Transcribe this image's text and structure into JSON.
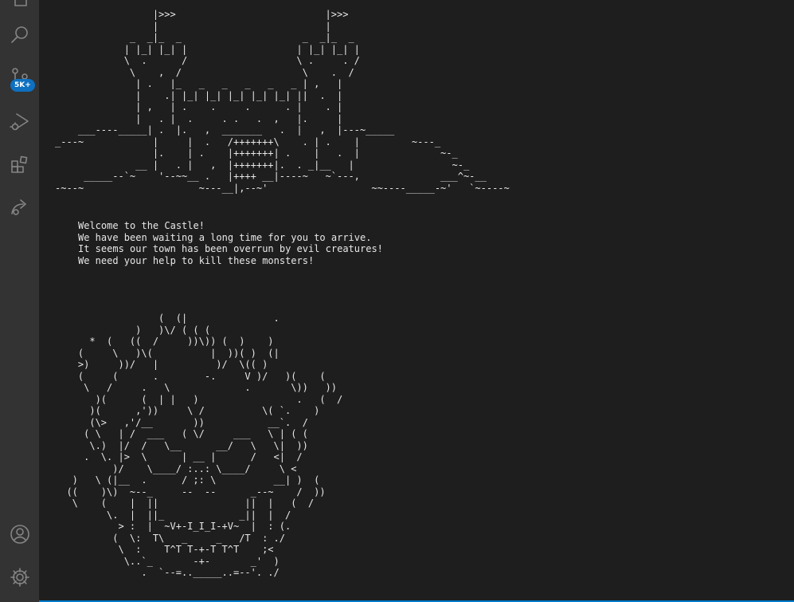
{
  "activity_bar": {
    "items": [
      {
        "name": "explorer",
        "icon": "files-icon"
      },
      {
        "name": "search",
        "icon": "search-icon"
      },
      {
        "name": "source-control",
        "icon": "source-control-icon"
      },
      {
        "name": "run-and-debug",
        "icon": "run-debug-icon"
      },
      {
        "name": "extensions",
        "icon": "extensions-icon"
      },
      {
        "name": "remote",
        "icon": "remote-icon"
      },
      {
        "name": "accounts",
        "icon": "account-icon"
      },
      {
        "name": "manage",
        "icon": "gear-icon"
      }
    ],
    "source_control_badge": "5K+",
    "badge_color": "#0e70c0"
  },
  "terminal": {
    "castle_art": "                 |>>>                          |>>>\n                 |                             |\n             _  _|_  _                     _  _|_  _\n            | |_| |_| |                   | |_| |_| |\n            \\  .      /                   \\ .     . /\n             \\    ,  /                     \\    .  /\n              | .   |_   _   _   _   _   _ | ,   |\n              |    .| |_| |_| |_| |_| |_| ||  .  |\n              | ,   | .    .     .      . |    . |\n              |   . |  .     . .   .  ,   |.     |\n    ___----_____| .  |.   ,  _______   .  |   ,  |---~_____\n_---~            |     |  .   /+++++++\\    . | .    |         ~---_\n                 |.    | .    |+++++++| .    |   .  |              ~-_\n              __ |   . |   ,  |+++++++|.  . _|__   |                 ~-_\n     _____--`~    '--~~__ .   |++++ __|----~   ~`---,              ___^~-__\n-~--~                    ~---__|,--~'                  ~~----_____-~'   `~----~",
    "message": [
      "Welcome to the Castle!",
      "We have been waiting a long time for you to arrive.",
      "It seems our town has been overrun by evil creatures!",
      "We need your help to kill these monsters!"
    ],
    "monster_art": "                  (  (|               .\n              )   )\\/ ( ( (\n      *  (   ((  /     ))\\)) (  )    )\n    (     \\   )\\(          |  ))( )  (|\n    >)     ))/   |          )/  \\(( )\n    (     (      .        -.     V )/   )(    (\n     \\   /     .   \\             .       \\))   ))\n       )(      (  | |   )                 .   (  /\n      )(      ,'))     \\ /          \\( `.    )\n      (\\>   ,'/__       ))           __`.  /\n     ( \\   | /  ___   ( \\/     ___   \\ | ( (\n      \\.)  |/  /   \\__      __/   \\   \\|  ))\n     .  \\. |>  \\      | __ |      /   <|  /\n          )/    \\____/ :..: \\____/     \\ <\n   )   \\ (|__  .      / ;: \\          __| )  (\n  ((    )\\)  ~--_     --  --      _--~    /  ))\n   \\    (    |  ||               ||  |   (  /\n         \\.  |  ||_             _||  |  /\n           > :  |  ~V+-I_I_I-+V~  |  : (.\n          (  \\:  T\\   _     _   /T  : ./\n           \\  :    T^T T-+-T T^T    ;<\n            \\..`_       -+-       _'  )\n               .  `--=.._____..=--'. ./"
  }
}
